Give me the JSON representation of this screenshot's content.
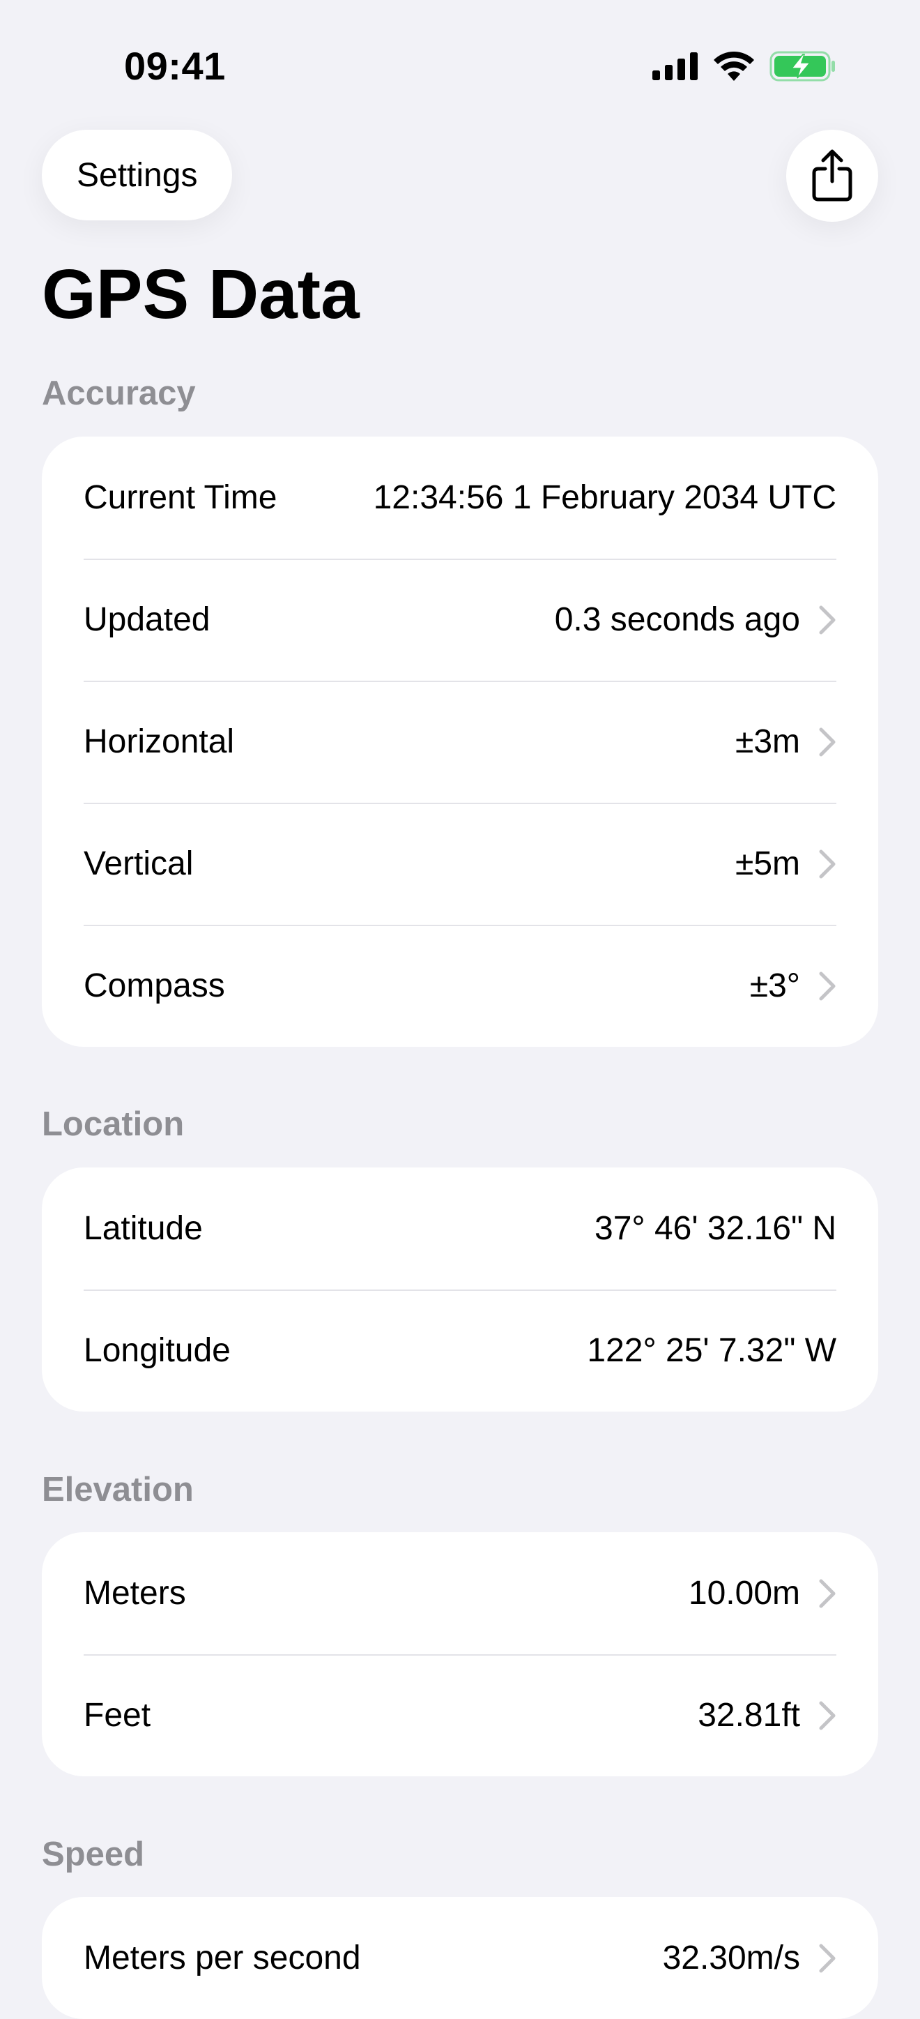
{
  "status_bar": {
    "time": "09:41",
    "icons": [
      "cellular-signal-icon",
      "wifi-icon",
      "battery-charging-icon"
    ],
    "battery_color": "#34C759"
  },
  "nav": {
    "back_label": "Settings",
    "share_icon": "share-icon"
  },
  "page": {
    "title": "GPS Data"
  },
  "colors": {
    "background": "#F2F2F7",
    "card": "#FFFFFF",
    "secondary_text": "#8E8E93",
    "chevron": "#C4C4C7"
  },
  "sections": {
    "accuracy": {
      "header": "Accuracy",
      "rows": [
        {
          "label": "Current Time",
          "value": "12:34:56 1 February 2034 UTC"
        },
        {
          "label": "Updated",
          "value": "0.3 seconds ago"
        },
        {
          "label": "Horizontal",
          "value": "±3m"
        },
        {
          "label": "Vertical",
          "value": "±5m"
        },
        {
          "label": "Compass",
          "value": "±3°"
        }
      ]
    },
    "location": {
      "header": "Location",
      "rows": [
        {
          "label": "Latitude",
          "value": "37° 46' 32.16\" N"
        },
        {
          "label": "Longitude",
          "value": "122° 25' 7.32\" W"
        }
      ]
    },
    "elevation": {
      "header": "Elevation",
      "rows": [
        {
          "label": "Meters",
          "value": "10.00m"
        },
        {
          "label": "Feet",
          "value": "32.81ft"
        }
      ]
    },
    "speed": {
      "header": "Speed",
      "rows": [
        {
          "label": "Meters per second",
          "value": "32.30m/s"
        }
      ]
    }
  }
}
